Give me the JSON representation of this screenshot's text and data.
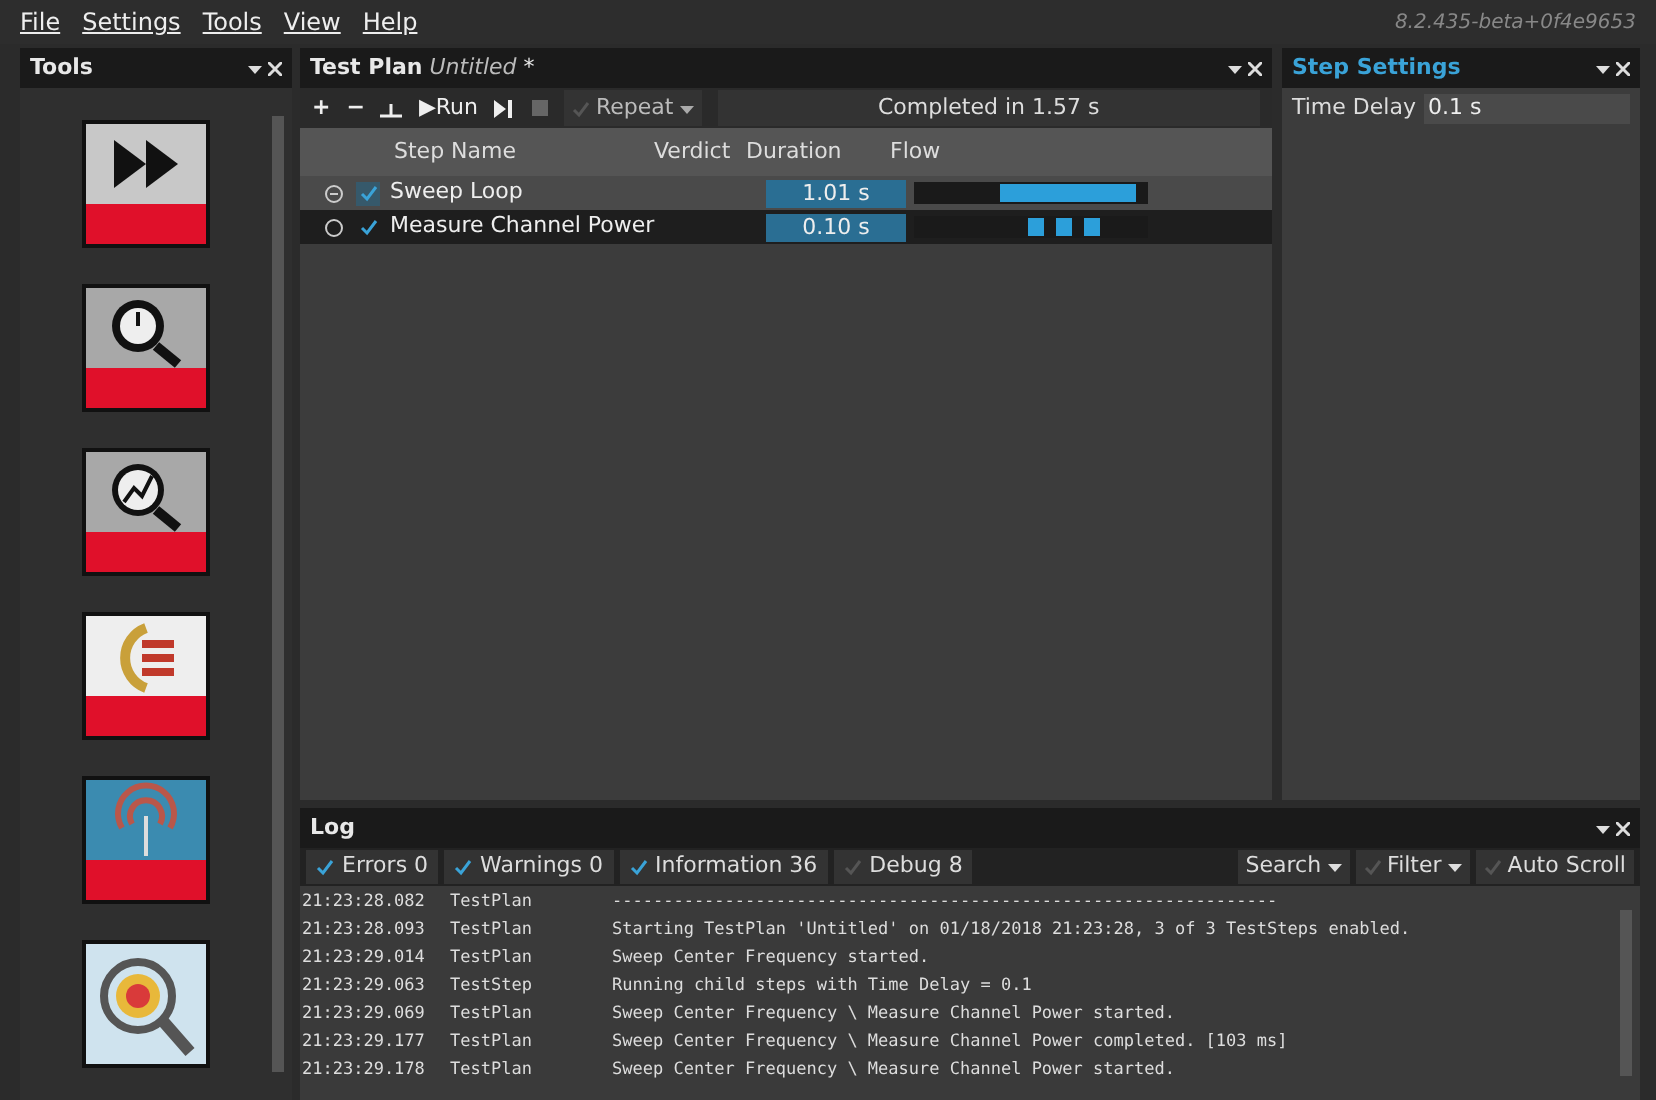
{
  "menu": [
    "File",
    "Settings",
    "Tools",
    "View",
    "Help"
  ],
  "version": "8.2.435-beta+0f4e9653",
  "tools_panel": {
    "title": "Tools",
    "tools": [
      {
        "kind": "fastforward"
      },
      {
        "kind": "stopwatch"
      },
      {
        "kind": "chart"
      },
      {
        "kind": "bars"
      },
      {
        "kind": "antenna"
      },
      {
        "kind": "wheel"
      }
    ]
  },
  "test_plan": {
    "title": "Test Plan",
    "name": "Untitled",
    "modified": "*",
    "toolbar": {
      "add": "+",
      "remove": "−",
      "run": "▶Run",
      "repeat": "Repeat",
      "repeat_checked": false
    },
    "status": "Completed in 1.57 s",
    "columns": [
      "Step Name",
      "Verdict",
      "Duration",
      "Flow"
    ],
    "steps": [
      {
        "name": "Sweep Loop",
        "kind": "loop",
        "expanded": true,
        "checked": true,
        "selected": true,
        "duration": "1.01 s"
      },
      {
        "name": "Measure Channel Power",
        "kind": "child",
        "checked": true,
        "selected": false,
        "duration": "0.10 s"
      }
    ]
  },
  "step_settings": {
    "title": "Step Settings",
    "label": "Time Delay",
    "value": "0.1 s"
  },
  "log": {
    "title": "Log",
    "filters": [
      {
        "label": "Errors 0",
        "checked": true
      },
      {
        "label": "Warnings 0",
        "checked": true
      },
      {
        "label": "Information 36",
        "checked": true
      },
      {
        "label": "Debug 8",
        "checked": false
      }
    ],
    "search": "Search",
    "filter": "Filter",
    "filter_checked": false,
    "auto_scroll": "Auto Scroll",
    "auto_scroll_checked": false,
    "rows": [
      {
        "time": "21:23:28.082",
        "source": "TestPlan",
        "message": "-----------------------------------------------------------------"
      },
      {
        "time": "21:23:28.093",
        "source": "TestPlan",
        "message": "Starting TestPlan 'Untitled' on 01/18/2018 21:23:28, 3 of 3 TestSteps enabled."
      },
      {
        "time": "21:23:29.014",
        "source": "TestPlan",
        "message": "Sweep Center Frequency started."
      },
      {
        "time": "21:23:29.063",
        "source": "TestStep",
        "message": "Running child steps with Time Delay = 0.1"
      },
      {
        "time": "21:23:29.069",
        "source": "TestPlan",
        "message": "Sweep Center Frequency \\ Measure Channel Power started."
      },
      {
        "time": "21:23:29.177",
        "source": "TestPlan",
        "message": "Sweep Center Frequency \\ Measure Channel Power completed. [103 ms]"
      },
      {
        "time": "21:23:29.178",
        "source": "TestPlan",
        "message": "Sweep Center Frequency \\ Measure Channel Power started."
      }
    ]
  }
}
